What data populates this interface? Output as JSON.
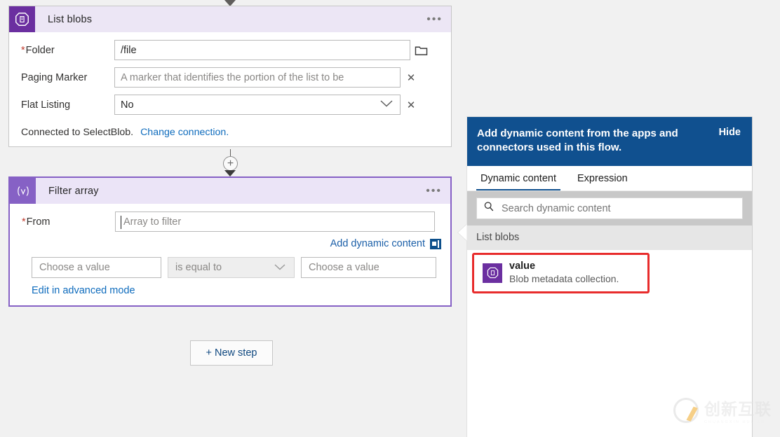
{
  "flow": {
    "list_blobs_card": {
      "title": "List blobs",
      "icon": "blob-storage-icon",
      "menu": "•••",
      "fields": [
        {
          "label": "Folder",
          "required": true,
          "value": "/file",
          "placeholder": "",
          "trailing_icon": "folder-picker-icon"
        },
        {
          "label": "Paging Marker",
          "required": false,
          "value": "",
          "placeholder": "A marker that identifies the portion of the list to be",
          "trailing_icon": "clear-x-icon"
        },
        {
          "label": "Flat Listing",
          "required": false,
          "value": "No",
          "placeholder": "",
          "trailing_icon": "clear-x-icon",
          "dropdown": true
        }
      ],
      "connection_text": "Connected to SelectBlob.",
      "change_connection_link": "Change connection."
    },
    "connector": {
      "add_label": "+"
    },
    "filter_array_card": {
      "title": "Filter array",
      "icon": "expression-icon",
      "icon_glyph": "⟨v⟩",
      "menu": "•••",
      "from_label": "From",
      "from_required": true,
      "from_value": "",
      "from_placeholder": "Array to filter",
      "add_dynamic_content": "Add dynamic content",
      "condition": {
        "left_placeholder": "Choose a value",
        "operator": "is equal to",
        "right_placeholder": "Choose a value"
      },
      "advanced_mode_link": "Edit in advanced mode"
    },
    "new_step_button": "+ New step"
  },
  "panel": {
    "header_text": "Add dynamic content from the apps and connectors used in this flow.",
    "hide_label": "Hide",
    "tabs": [
      {
        "label": "Dynamic content",
        "active": true
      },
      {
        "label": "Expression",
        "active": false
      }
    ],
    "search": {
      "placeholder": "Search dynamic content",
      "icon": "search-icon"
    },
    "group_label": "List blobs",
    "items": [
      {
        "name": "value",
        "description": "Blob metadata collection.",
        "icon": "blob-storage-icon",
        "highlighted": true
      }
    ]
  },
  "watermark": {
    "text": "创新互联",
    "subtext": "CHUANGXIN HULIAN"
  },
  "colors": {
    "accent_purple": "#6b2fa0",
    "selected_purple": "#8661c5",
    "panel_blue": "#10508f",
    "link_blue": "#0f6cbd",
    "highlight_red": "#e82c2c",
    "page_bg": "#f1f1f1"
  }
}
